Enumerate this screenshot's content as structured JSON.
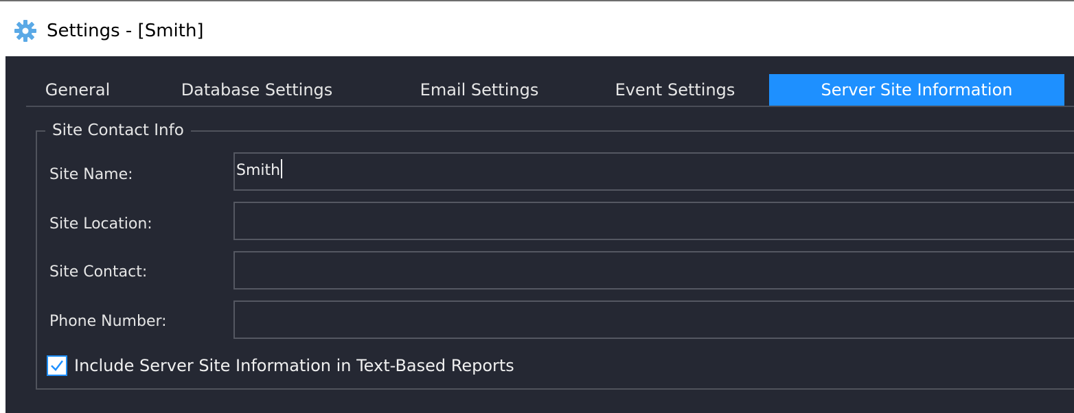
{
  "window": {
    "title": "Settings - [Smith]",
    "icon": "gear-icon"
  },
  "tabs": [
    {
      "label": "General",
      "active": false
    },
    {
      "label": "Database Settings",
      "active": false
    },
    {
      "label": "Email Settings",
      "active": false
    },
    {
      "label": "Event Settings",
      "active": false
    },
    {
      "label": "Server Site Information",
      "active": true
    }
  ],
  "group": {
    "legend": "Site Contact Info",
    "fields": [
      {
        "label": "Site Name:",
        "value": "Smith"
      },
      {
        "label": "Site Location:",
        "value": ""
      },
      {
        "label": "Site Contact:",
        "value": ""
      },
      {
        "label": "Phone Number:",
        "value": ""
      }
    ],
    "checkbox": {
      "label": "Include Server Site Information in Text-Based Reports",
      "checked": true
    }
  },
  "colors": {
    "background": "#252833",
    "accent": "#1e90ff",
    "text": "#e6e6e6"
  }
}
